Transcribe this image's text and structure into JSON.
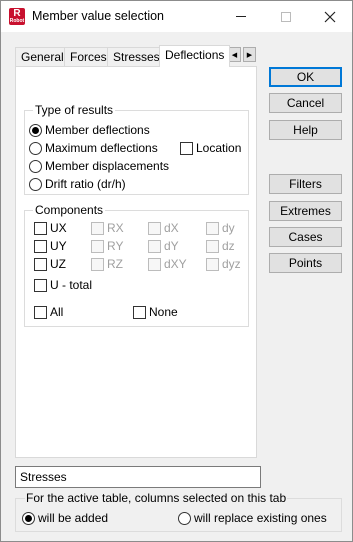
{
  "window": {
    "title": "Member value selection",
    "icon_letter": "R",
    "icon_sub": "Robot",
    "minimize_icon": "minimize-icon",
    "maximize_icon": "maximize-icon",
    "close_icon": "close-icon"
  },
  "tabs": [
    {
      "label": "General",
      "active": false
    },
    {
      "label": "Forces",
      "active": false
    },
    {
      "label": "Stresses",
      "active": false
    },
    {
      "label": "Deflections",
      "active": true
    }
  ],
  "tab_scroll": {
    "left": "◀",
    "right": "▶"
  },
  "type_of_results": {
    "legend": "Type of results",
    "options": [
      {
        "label": "Member deflections",
        "selected": true
      },
      {
        "label": "Maximum deflections",
        "selected": false
      },
      {
        "label": "Member displacements",
        "selected": false
      },
      {
        "label": "Drift ratio (dr/h)",
        "selected": false
      }
    ],
    "location_label": "Location"
  },
  "components": {
    "legend": "Components",
    "col1": [
      "UX",
      "UY",
      "UZ"
    ],
    "col2": [
      "RX",
      "RY",
      "RZ"
    ],
    "col3": [
      "dX",
      "dY",
      "dXY"
    ],
    "col4": [
      "dy",
      "dz",
      "dyz"
    ],
    "u_total": "U - total",
    "all": "All",
    "none": "None"
  },
  "buttons": {
    "ok": "OK",
    "cancel": "Cancel",
    "help": "Help",
    "filters": "Filters",
    "extremes": "Extremes",
    "cases": "Cases",
    "points": "Points"
  },
  "table_name": {
    "value": "Stresses"
  },
  "bottom": {
    "legend": "For the active table, columns selected on this tab",
    "added": "will be added",
    "replace": "will replace existing ones",
    "added_selected": true
  }
}
